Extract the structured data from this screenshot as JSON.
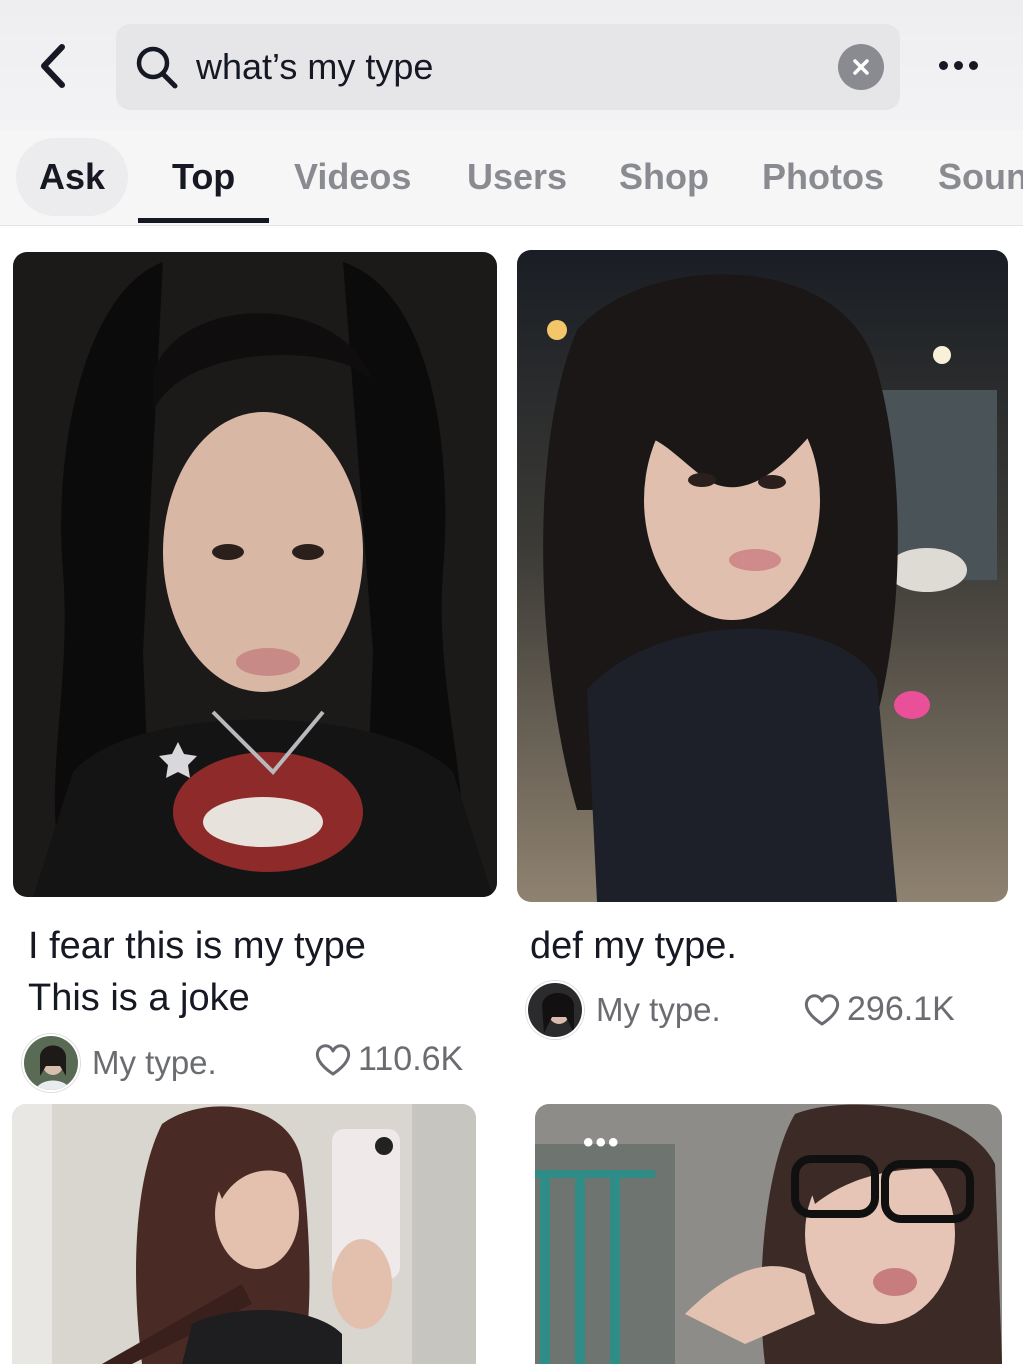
{
  "search": {
    "query": "what’s my type"
  },
  "icons": {
    "back": "chevron-left-icon",
    "search": "search-icon",
    "clear": "close-icon",
    "more": "more-horizontal-icon",
    "like": "heart-icon"
  },
  "tabs": [
    {
      "label": "Ask"
    },
    {
      "label": "Top",
      "active": true
    },
    {
      "label": "Videos"
    },
    {
      "label": "Users"
    },
    {
      "label": "Shop"
    },
    {
      "label": "Photos"
    },
    {
      "label": "Soun"
    }
  ],
  "results": [
    {
      "caption_line1": "I fear this is my type",
      "caption_line2": "This is a joke",
      "author": "My type.",
      "likes": "110.6K"
    },
    {
      "caption_line1": "def my type.",
      "author": "My type.",
      "likes": "296.1K"
    },
    {
      "indicator": "•••"
    }
  ],
  "colors": {
    "text_primary": "#161823",
    "text_secondary": "#8a8b91",
    "search_bg": "#e6e6e9"
  }
}
